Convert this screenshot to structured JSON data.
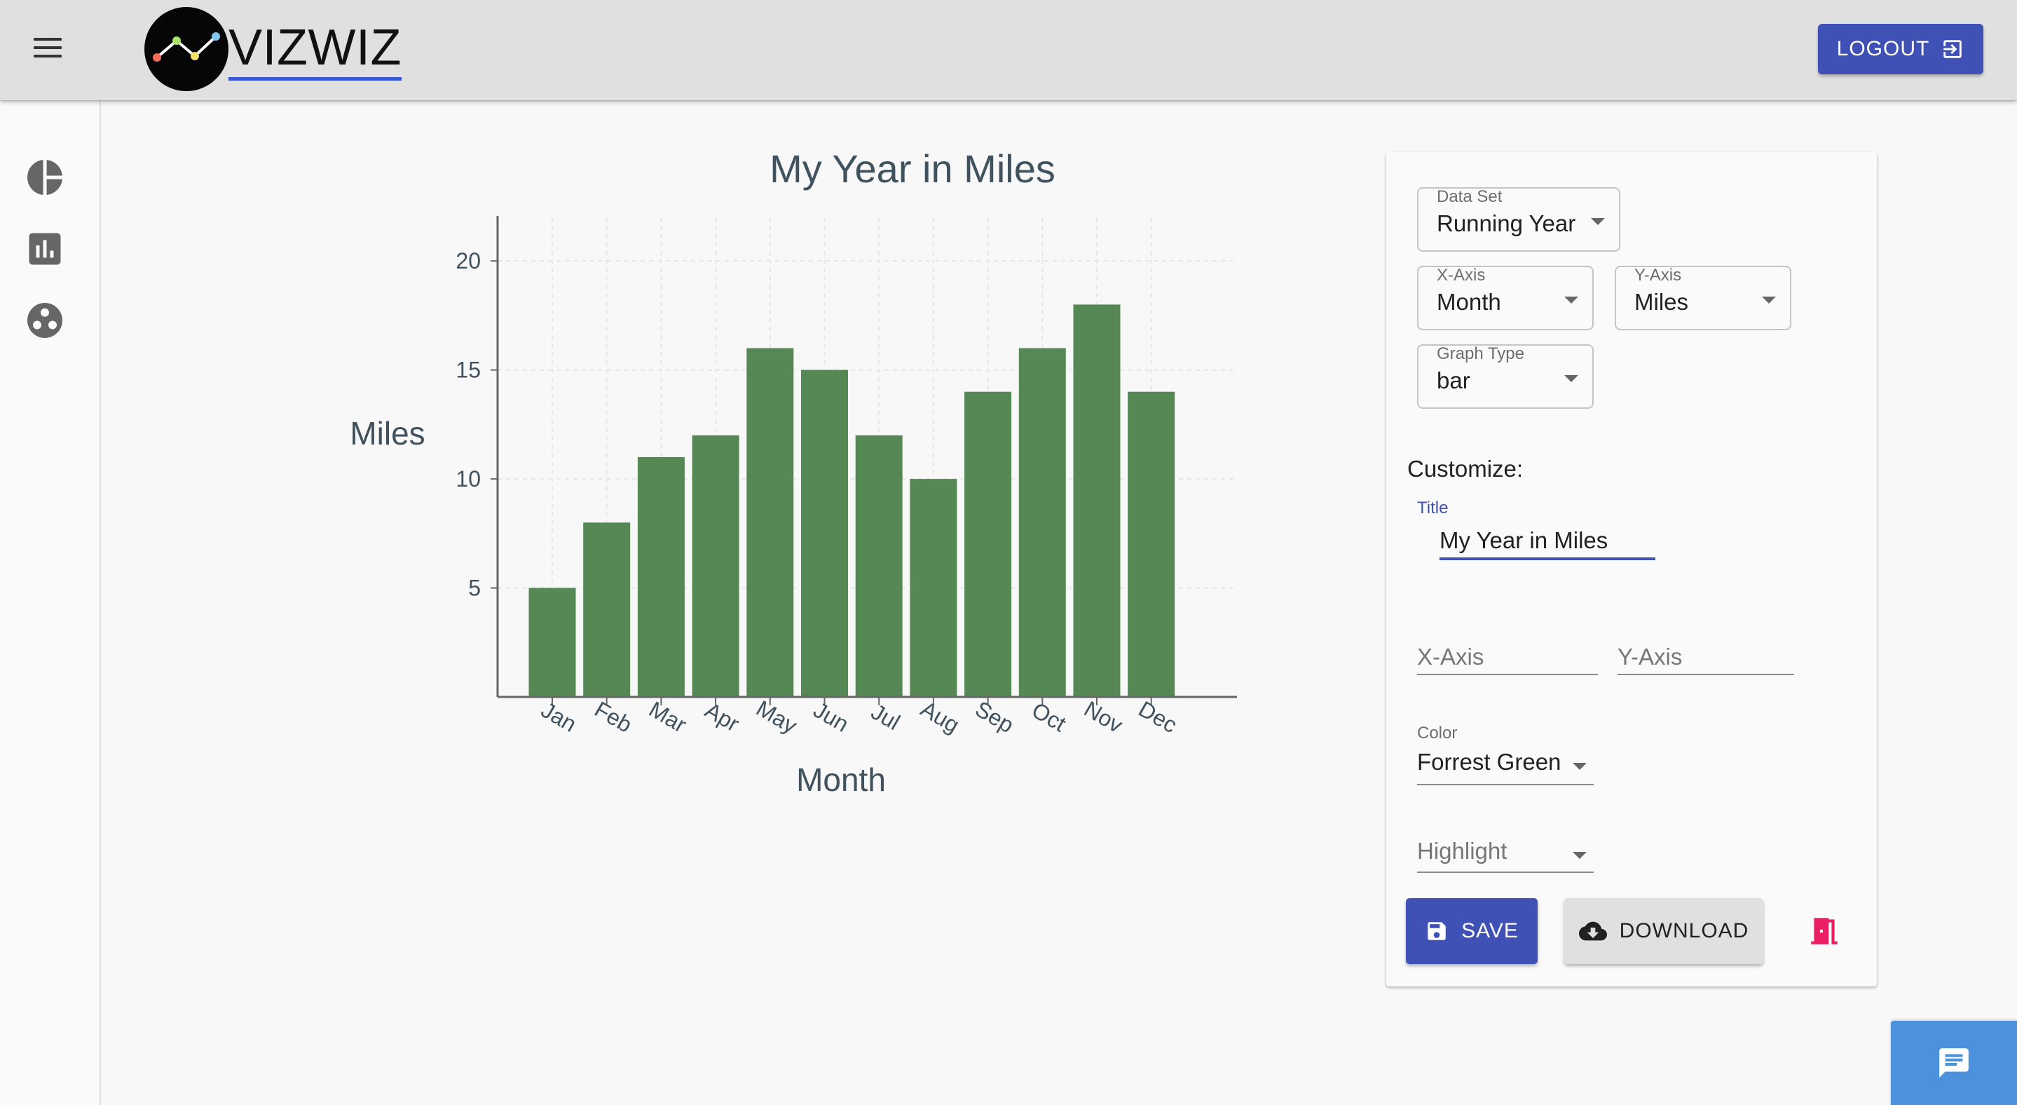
{
  "app": {
    "brand": "VIZWIZ"
  },
  "header": {
    "menu_icon": "hamburger-menu-icon",
    "logout_label": "LOGOUT",
    "logout_icon": "exit-to-app-icon"
  },
  "sidebar": {
    "items": [
      {
        "icon": "pie-chart-icon"
      },
      {
        "icon": "bar-chart-icon"
      },
      {
        "icon": "bubble-chart-icon"
      }
    ]
  },
  "chart_data": {
    "type": "bar",
    "title": "My Year in Miles",
    "xlabel": "Month",
    "ylabel": "Miles",
    "categories": [
      "Jan",
      "Feb",
      "Mar",
      "Apr",
      "May",
      "Jun",
      "Jul",
      "Aug",
      "Sep",
      "Oct",
      "Nov",
      "Dec"
    ],
    "values": [
      5,
      8,
      11,
      12,
      16,
      15,
      12,
      10,
      14,
      16,
      18,
      14
    ],
    "ylim": [
      0,
      22
    ],
    "yticks": [
      5,
      10,
      15,
      20
    ],
    "grid": true,
    "bar_color": "#558855",
    "text_color": "#41525f"
  },
  "options": {
    "dataset": {
      "label": "Data Set",
      "value": "Running Year"
    },
    "x_axis": {
      "label": "X-Axis",
      "value": "Month"
    },
    "y_axis": {
      "label": "Y-Axis",
      "value": "Miles"
    },
    "graph_type": {
      "label": "Graph Type",
      "value": "bar"
    },
    "customize_label": "Customize:",
    "title_field": {
      "label": "Title",
      "value": "My Year in Miles"
    },
    "x_axis_field": {
      "placeholder": "X-Axis"
    },
    "y_axis_field": {
      "placeholder": "Y-Axis"
    },
    "color": {
      "label": "Color",
      "value": "Forrest Green"
    },
    "highlight": {
      "placeholder": "Highlight"
    },
    "save_label": "SAVE",
    "download_label": "DOWNLOAD"
  },
  "colors": {
    "primary": "#3f51b5",
    "appbar": "#e0e0e0",
    "exit_icon": "#e91e63",
    "chat_fab": "#4b91dc"
  }
}
